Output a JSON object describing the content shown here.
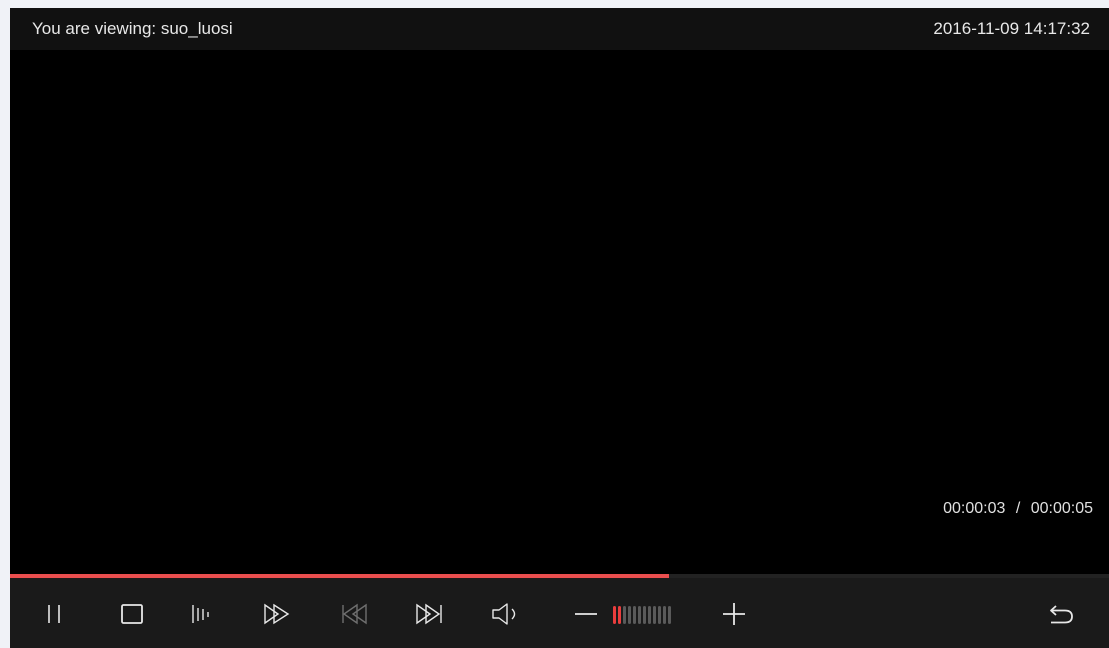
{
  "header": {
    "viewing_label": "You are viewing: suo_luosi",
    "datetime": "2016-11-09 14:17:32"
  },
  "playback": {
    "elapsed": "00:00:03",
    "separator": "/",
    "total": "00:00:05",
    "progress_fraction": 0.6
  },
  "controls": {
    "icons": [
      "pause-icon",
      "stop-icon",
      "slow-play-icon",
      "fast-forward-icon",
      "previous-frame-icon",
      "next-frame-icon",
      "speaker-icon",
      "volume-minus-icon",
      "volume-plus-icon",
      "back-icon"
    ],
    "volume": {
      "level": 2,
      "segments": 12
    }
  },
  "colors": {
    "accent": "#ea4f4f",
    "icon": "#e8e8e8",
    "icon_disabled": "#6f6f6f",
    "panel": "#1a1a1a",
    "video": "#000000"
  }
}
